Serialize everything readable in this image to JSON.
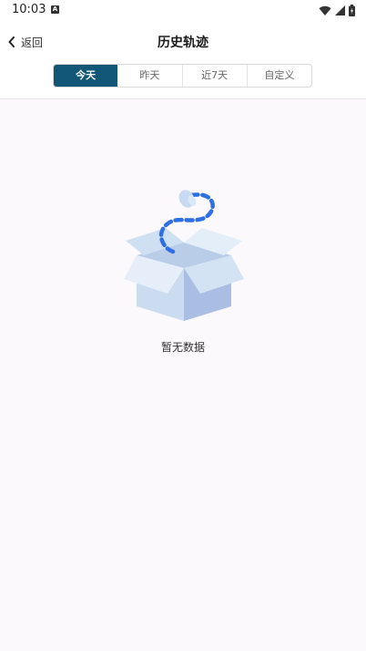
{
  "status_bar": {
    "time": "10:03",
    "notification_badge": "A",
    "icons": [
      "wifi-icon",
      "signal-icon",
      "battery-icon"
    ]
  },
  "header": {
    "back_label": "返回",
    "title": "历史轨迹"
  },
  "tabs": [
    {
      "label": "今天",
      "active": true
    },
    {
      "label": "昨天",
      "active": false
    },
    {
      "label": "近7天",
      "active": false
    },
    {
      "label": "自定义",
      "active": false
    }
  ],
  "empty_state": {
    "icon": "empty-box-icon",
    "text": "暂无数据"
  },
  "colors": {
    "accent": "#115677",
    "background": "#fcf9fd",
    "box_light": "#cfe0f2",
    "box_dark": "#a8bde0",
    "path_blue": "#2f6fe4"
  }
}
